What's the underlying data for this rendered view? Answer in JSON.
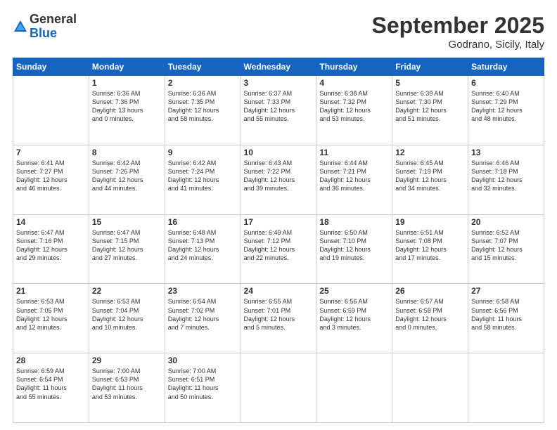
{
  "logo": {
    "general": "General",
    "blue": "Blue"
  },
  "title": "September 2025",
  "location": "Godrano, Sicily, Italy",
  "weekdays": [
    "Sunday",
    "Monday",
    "Tuesday",
    "Wednesday",
    "Thursday",
    "Friday",
    "Saturday"
  ],
  "weeks": [
    [
      {
        "day": "",
        "info": ""
      },
      {
        "day": "1",
        "info": "Sunrise: 6:36 AM\nSunset: 7:36 PM\nDaylight: 13 hours\nand 0 minutes."
      },
      {
        "day": "2",
        "info": "Sunrise: 6:36 AM\nSunset: 7:35 PM\nDaylight: 12 hours\nand 58 minutes."
      },
      {
        "day": "3",
        "info": "Sunrise: 6:37 AM\nSunset: 7:33 PM\nDaylight: 12 hours\nand 55 minutes."
      },
      {
        "day": "4",
        "info": "Sunrise: 6:38 AM\nSunset: 7:32 PM\nDaylight: 12 hours\nand 53 minutes."
      },
      {
        "day": "5",
        "info": "Sunrise: 6:39 AM\nSunset: 7:30 PM\nDaylight: 12 hours\nand 51 minutes."
      },
      {
        "day": "6",
        "info": "Sunrise: 6:40 AM\nSunset: 7:29 PM\nDaylight: 12 hours\nand 48 minutes."
      }
    ],
    [
      {
        "day": "7",
        "info": "Sunrise: 6:41 AM\nSunset: 7:27 PM\nDaylight: 12 hours\nand 46 minutes."
      },
      {
        "day": "8",
        "info": "Sunrise: 6:42 AM\nSunset: 7:26 PM\nDaylight: 12 hours\nand 44 minutes."
      },
      {
        "day": "9",
        "info": "Sunrise: 6:42 AM\nSunset: 7:24 PM\nDaylight: 12 hours\nand 41 minutes."
      },
      {
        "day": "10",
        "info": "Sunrise: 6:43 AM\nSunset: 7:22 PM\nDaylight: 12 hours\nand 39 minutes."
      },
      {
        "day": "11",
        "info": "Sunrise: 6:44 AM\nSunset: 7:21 PM\nDaylight: 12 hours\nand 36 minutes."
      },
      {
        "day": "12",
        "info": "Sunrise: 6:45 AM\nSunset: 7:19 PM\nDaylight: 12 hours\nand 34 minutes."
      },
      {
        "day": "13",
        "info": "Sunrise: 6:46 AM\nSunset: 7:18 PM\nDaylight: 12 hours\nand 32 minutes."
      }
    ],
    [
      {
        "day": "14",
        "info": "Sunrise: 6:47 AM\nSunset: 7:16 PM\nDaylight: 12 hours\nand 29 minutes."
      },
      {
        "day": "15",
        "info": "Sunrise: 6:47 AM\nSunset: 7:15 PM\nDaylight: 12 hours\nand 27 minutes."
      },
      {
        "day": "16",
        "info": "Sunrise: 6:48 AM\nSunset: 7:13 PM\nDaylight: 12 hours\nand 24 minutes."
      },
      {
        "day": "17",
        "info": "Sunrise: 6:49 AM\nSunset: 7:12 PM\nDaylight: 12 hours\nand 22 minutes."
      },
      {
        "day": "18",
        "info": "Sunrise: 6:50 AM\nSunset: 7:10 PM\nDaylight: 12 hours\nand 19 minutes."
      },
      {
        "day": "19",
        "info": "Sunrise: 6:51 AM\nSunset: 7:08 PM\nDaylight: 12 hours\nand 17 minutes."
      },
      {
        "day": "20",
        "info": "Sunrise: 6:52 AM\nSunset: 7:07 PM\nDaylight: 12 hours\nand 15 minutes."
      }
    ],
    [
      {
        "day": "21",
        "info": "Sunrise: 6:53 AM\nSunset: 7:05 PM\nDaylight: 12 hours\nand 12 minutes."
      },
      {
        "day": "22",
        "info": "Sunrise: 6:53 AM\nSunset: 7:04 PM\nDaylight: 12 hours\nand 10 minutes."
      },
      {
        "day": "23",
        "info": "Sunrise: 6:54 AM\nSunset: 7:02 PM\nDaylight: 12 hours\nand 7 minutes."
      },
      {
        "day": "24",
        "info": "Sunrise: 6:55 AM\nSunset: 7:01 PM\nDaylight: 12 hours\nand 5 minutes."
      },
      {
        "day": "25",
        "info": "Sunrise: 6:56 AM\nSunset: 6:59 PM\nDaylight: 12 hours\nand 3 minutes."
      },
      {
        "day": "26",
        "info": "Sunrise: 6:57 AM\nSunset: 6:58 PM\nDaylight: 12 hours\nand 0 minutes."
      },
      {
        "day": "27",
        "info": "Sunrise: 6:58 AM\nSunset: 6:56 PM\nDaylight: 11 hours\nand 58 minutes."
      }
    ],
    [
      {
        "day": "28",
        "info": "Sunrise: 6:59 AM\nSunset: 6:54 PM\nDaylight: 11 hours\nand 55 minutes."
      },
      {
        "day": "29",
        "info": "Sunrise: 7:00 AM\nSunset: 6:53 PM\nDaylight: 11 hours\nand 53 minutes."
      },
      {
        "day": "30",
        "info": "Sunrise: 7:00 AM\nSunset: 6:51 PM\nDaylight: 11 hours\nand 50 minutes."
      },
      {
        "day": "",
        "info": ""
      },
      {
        "day": "",
        "info": ""
      },
      {
        "day": "",
        "info": ""
      },
      {
        "day": "",
        "info": ""
      }
    ]
  ]
}
